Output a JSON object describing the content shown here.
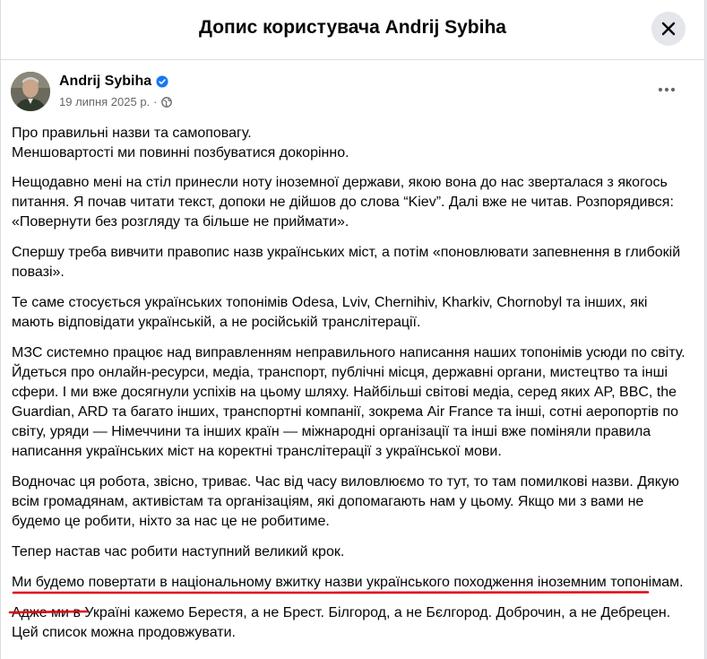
{
  "modal": {
    "title": "Допис користувача Andrij Sybiha",
    "close_icon": "close-icon"
  },
  "post": {
    "author": "Andrij Sybiha",
    "verified_icon": "verified-badge-icon",
    "date": "19 липня 2025 р.",
    "separator": "·",
    "audience_icon": "globe-icon",
    "more_icon": "more-horizontal-icon",
    "paragraphs": [
      "Про правильні назви та самоповагу.\nМеншовартості ми повинні позбуватися докорінно.",
      "Нещодавно мені на стіл принесли ноту іноземної держави, якою вона до нас зверталася з якогось питання. Я почав читати текст, допоки не дійшов до слова “Kiev”. Далі вже не читав. Розпорядився: «Повернути без розгляду та більше не приймати».",
      "Спершу треба вивчити правопис назв українських міст, а потім «поновлювати запевнення в глибокій повазі».",
      "Те саме стосується українських топонімів Odesa, Lviv, Chernihiv, Kharkiv, Chornobyl та інших, які мають відповідати українській, а не російській транслітерації.",
      "МЗС системно працює над виправленням неправильного написання наших топонімів усюди по світу. Йдеться про онлайн-ресурси, медіа, транспорт, публічні місця, державні органи, мистецтво та інші сфери. І ми вже досягнули успіхів на цьому шляху. Найбільші світові медіа, серед яких AP, BBC, the Guardian, ARD та багато інших, транспортні компанії, зокрема Air France та інші, сотні аеропортів по світу, уряди — Німеччини та інших країн — міжнародні організації та інші вже поміняли правила написання українських міст на коректні транслітерації з української мови.",
      "Водночас ця робота, звісно, триває. Час від часу виловлюємо то тут, то там помилкові назви. Дякую всім громадянам, активістам та організаціям, які допомагають нам у цьому. Якщо ми з вами не будемо це робити, ніхто за нас це не робитиме.",
      "Тепер настав час робити наступний великий крок.",
      "Ми будемо повертати в національному вжитку назви українського походження іноземним топонімам.",
      "Адже ми в Україні кажемо Берестя, а не Брест. Білгород, а не Бєлгород. Доброчин, а не Дебрецен. Цей список можна продовжувати."
    ]
  },
  "colors": {
    "accent_blue": "#1877f2",
    "underline_red": "#e4000f",
    "secondary_text": "#65676b"
  }
}
